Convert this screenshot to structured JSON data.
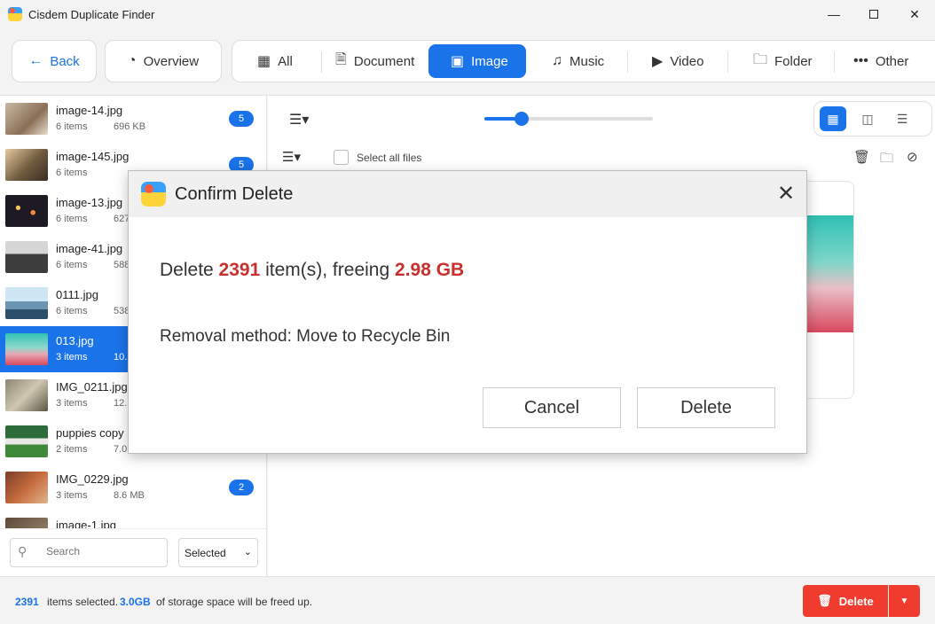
{
  "window": {
    "title": "Cisdem Duplicate Finder",
    "min": "—",
    "close": "✕"
  },
  "toolbar": {
    "back_label": "Back",
    "overview_label": "Overview",
    "filters": [
      {
        "label": "All",
        "icon": "grid-icon"
      },
      {
        "label": "Document",
        "icon": "document-icon"
      },
      {
        "label": "Image",
        "icon": "image-icon",
        "active": true
      },
      {
        "label": "Music",
        "icon": "music-icon"
      },
      {
        "label": "Video",
        "icon": "video-icon"
      },
      {
        "label": "Folder",
        "icon": "folder-icon"
      },
      {
        "label": "Other",
        "icon": "more-icon"
      }
    ]
  },
  "sidebar": {
    "groups": [
      {
        "name": "image-14.jpg",
        "items": "6 items",
        "size": "696 KB",
        "badge": "5"
      },
      {
        "name": "image-145.jpg",
        "items": "6 items",
        "size": "",
        "badge": "5"
      },
      {
        "name": "image-13.jpg",
        "items": "6 items",
        "size": "627",
        "badge": ""
      },
      {
        "name": "image-41.jpg",
        "items": "6 items",
        "size": "588",
        "badge": ""
      },
      {
        "name": "0111.jpg",
        "items": "6 items",
        "size": "538",
        "badge": ""
      },
      {
        "name": "013.jpg",
        "items": "3 items",
        "size": "10.",
        "badge": "",
        "selected": true
      },
      {
        "name": "IMG_0211.jpg",
        "items": "3 items",
        "size": "12.",
        "badge": ""
      },
      {
        "name": "puppies copy",
        "items": "2 items",
        "size": "7.0",
        "badge": ""
      },
      {
        "name": "IMG_0229.jpg",
        "items": "3 items",
        "size": "8.6 MB",
        "badge": "2"
      },
      {
        "name": "image-1.jpg",
        "items": "",
        "size": "",
        "badge": ""
      }
    ],
    "search_placeholder": "Search",
    "filter_value": "Selected"
  },
  "main": {
    "select_all_label": "Select all files",
    "zoom_fraction": 0.22
  },
  "status": {
    "count": "2391",
    "text1": "items selected.",
    "size": "3.0GB",
    "text2": "of storage space will be freed up.",
    "delete_label": "Delete"
  },
  "dialog": {
    "title": "Confirm Delete",
    "msg_prefix": "Delete",
    "count": "2391",
    "msg_mid": "item(s), freeing",
    "size": "2.98 GB",
    "removal": "Removal method: Move to Recycle Bin",
    "cancel_label": "Cancel",
    "delete_label": "Delete"
  },
  "colors": {
    "accent": "#1a73e8",
    "danger": "#f03c2f",
    "dialog_red": "#c9302c"
  }
}
